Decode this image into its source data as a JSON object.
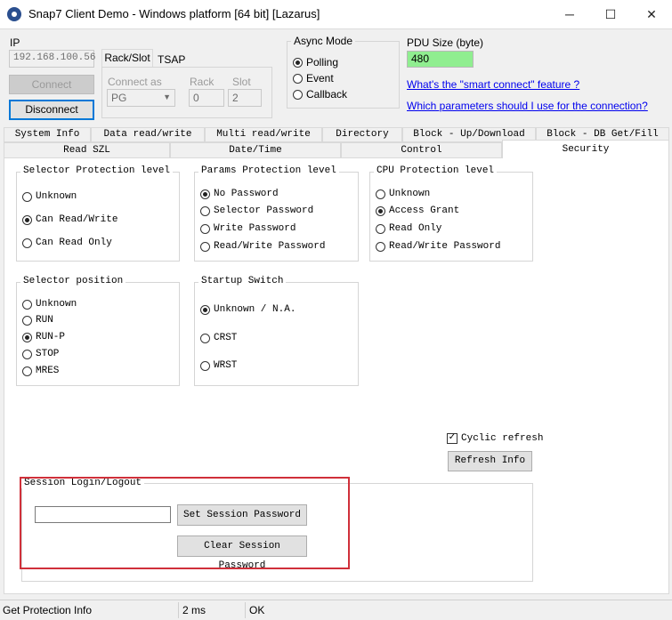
{
  "window": {
    "title": "Snap7 Client Demo - Windows platform [64 bit] [Lazarus]",
    "min_icon": "─",
    "max_icon": "☐",
    "close_icon": "✕"
  },
  "connection": {
    "ip_label": "IP",
    "ip_value": "192.168.100.56",
    "connect_label": "Connect",
    "disconnect_label": "Disconnect",
    "tabs": [
      "Rack/Slot",
      "TSAP"
    ],
    "connect_as_label": "Connect as",
    "connect_as_value": "PG",
    "rack_label": "Rack",
    "rack_value": "0",
    "slot_label": "Slot",
    "slot_value": "2"
  },
  "async": {
    "label": "Async Mode",
    "options": [
      "Polling",
      "Event",
      "Callback"
    ],
    "selected": "Polling"
  },
  "pdu": {
    "label": "PDU Size (byte)",
    "value": "480"
  },
  "links": {
    "smart_connect": "What's the \"smart connect\" feature ?",
    "params": "Which parameters should I use for the connection?"
  },
  "tabs_row1": [
    "System Info",
    "Data read/write",
    "Multi read/write",
    "Directory",
    "Block - Up/Download",
    "Block - DB Get/Fill"
  ],
  "tabs_row2": [
    "Read SZL",
    "Date/Time",
    "Control",
    "Security"
  ],
  "selector_protection": {
    "label": "Selector Protection level",
    "options": [
      "Unknown",
      "Can Read/Write",
      "Can Read Only"
    ]
  },
  "params_protection": {
    "label": "Params Protection level",
    "options": [
      "No Password",
      "Selector Password",
      "Write Password",
      "Read/Write Password"
    ]
  },
  "cpu_protection": {
    "label": "CPU Protection level",
    "options": [
      "Unknown",
      "Access Grant",
      "Read Only",
      "Read/Write Password"
    ]
  },
  "selector_position": {
    "label": "Selector position",
    "options": [
      "Unknown",
      "RUN",
      "RUN-P",
      "STOP",
      "MRES"
    ]
  },
  "startup_switch": {
    "label": "Startup Switch",
    "options": [
      "Unknown / N.A.",
      "CRST",
      "WRST"
    ]
  },
  "cyclic_refresh_label": "Cyclic refresh",
  "refresh_label": "Refresh Info",
  "session": {
    "label": "Session Login/Logout",
    "password_value": "",
    "set_label": "Set Session Password",
    "clear_label": "Clear Session Password"
  },
  "status": {
    "message": "Get Protection Info",
    "time": "2 ms",
    "result": "OK"
  },
  "colors": {
    "pdu_bg": "#90ee90",
    "highlight_border": "#d0303a",
    "focus_border": "#0078d7"
  }
}
